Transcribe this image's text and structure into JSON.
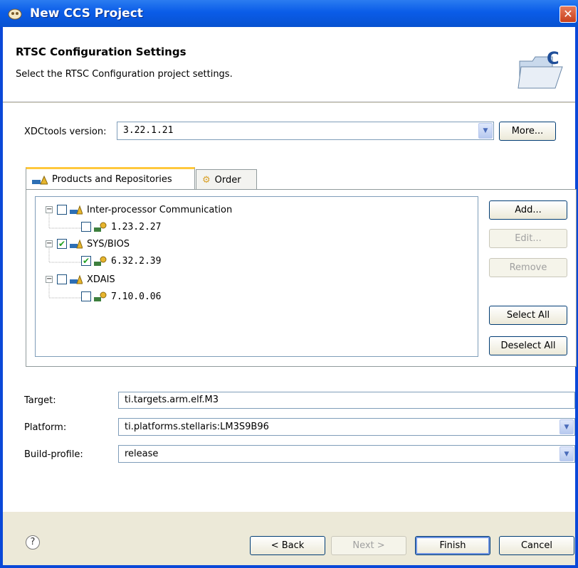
{
  "window": {
    "title": "New CCS Project"
  },
  "banner": {
    "title": "RTSC Configuration Settings",
    "description": "Select the RTSC Configuration project settings."
  },
  "xdc": {
    "label": "XDCtools version:",
    "value": "3.22.1.21",
    "more_button": "More..."
  },
  "tabs": [
    {
      "label": "Products and Repositories",
      "active": true
    },
    {
      "label": "Order",
      "active": false
    }
  ],
  "tree": [
    {
      "label": "Inter-processor Communication",
      "checked": false,
      "level": 0,
      "expander": "−"
    },
    {
      "label": "1.23.2.27",
      "checked": false,
      "level": 1
    },
    {
      "label": "SYS/BIOS",
      "checked": true,
      "level": 0,
      "expander": "−"
    },
    {
      "label": "6.32.2.39",
      "checked": true,
      "level": 1
    },
    {
      "label": "XDAIS",
      "checked": false,
      "level": 0,
      "expander": "−"
    },
    {
      "label": "7.10.0.06",
      "checked": false,
      "level": 1
    }
  ],
  "side_buttons": {
    "add": "Add...",
    "edit": "Edit...",
    "remove": "Remove",
    "select_all": "Select All",
    "deselect_all": "Deselect All"
  },
  "target": {
    "label": "Target:",
    "value": "ti.targets.arm.elf.M3"
  },
  "platform": {
    "label": "Platform:",
    "value": "ti.platforms.stellaris:LM3S9B96"
  },
  "build_profile": {
    "label": "Build-profile:",
    "value": "release"
  },
  "footer": {
    "help": "?",
    "back": "< Back",
    "next": "Next >",
    "finish": "Finish",
    "cancel": "Cancel"
  },
  "colors": {
    "title_bar": "#0a5ce8",
    "check": "#21a121",
    "tab_accent": "#ffc83c"
  }
}
